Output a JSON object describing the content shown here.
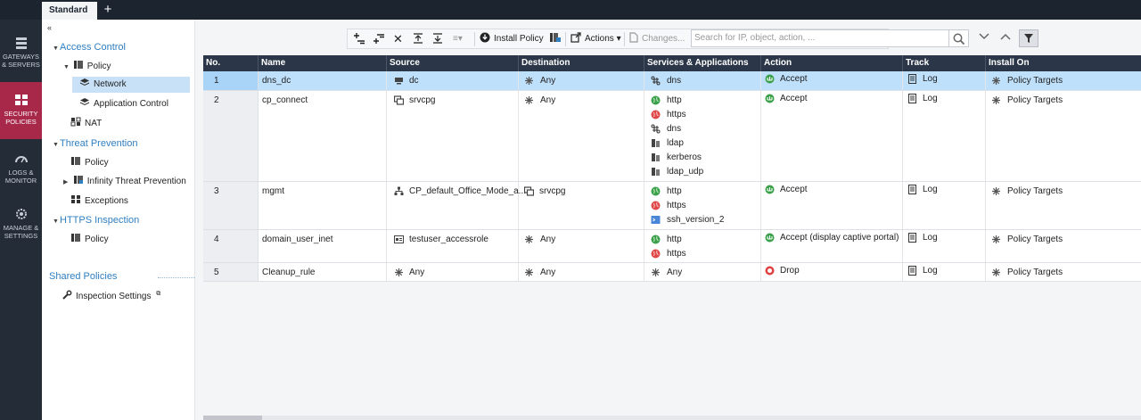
{
  "tabs": {
    "active": "Standard",
    "add": "+"
  },
  "leftnav": {
    "items": [
      {
        "label1": "GATEWAYS",
        "label2": "& SERVERS"
      },
      {
        "label1": "SECURITY",
        "label2": "POLICIES"
      },
      {
        "label1": "LOGS &",
        "label2": "MONITOR"
      },
      {
        "label1": "MANAGE &",
        "label2": "SETTINGS"
      }
    ]
  },
  "tree": {
    "collapse": "«",
    "access_control": "Access Control",
    "policy": "Policy",
    "network": "Network",
    "application_control": "Application Control",
    "nat": "NAT",
    "threat_prevention": "Threat Prevention",
    "tp_policy": "Policy",
    "infinity": "Infinity Threat Prevention",
    "exceptions": "Exceptions",
    "https_inspection": "HTTPS Inspection",
    "https_policy": "Policy",
    "shared_policies": "Shared Policies",
    "inspection_settings": "Inspection Settings"
  },
  "toolbar": {
    "install_policy": "Install Policy",
    "actions": "Actions ▾",
    "changes": "Changes...",
    "search_placeholder": "Search for IP, object, action, ..."
  },
  "columns": {
    "no": "No.",
    "name": "Name",
    "source": "Source",
    "destination": "Destination",
    "services": "Services & Applications",
    "action": "Action",
    "track": "Track",
    "install_on": "Install On"
  },
  "rows": [
    {
      "no": "1",
      "name": "dns_dc",
      "source": "dc",
      "destination": "Any",
      "services": [
        "dns"
      ],
      "action": "Accept",
      "track": "Log",
      "install_on": "Policy Targets"
    },
    {
      "no": "2",
      "name": "cp_connect",
      "source": "srvcpg",
      "destination": "Any",
      "services": [
        "http",
        "https",
        "dns",
        "ldap",
        "kerberos",
        "ldap_udp"
      ],
      "action": "Accept",
      "track": "Log",
      "install_on": "Policy Targets"
    },
    {
      "no": "3",
      "name": "mgmt",
      "source": "CP_default_Office_Mode_a...",
      "destination": "srvcpg",
      "services": [
        "http",
        "https",
        "ssh_version_2"
      ],
      "action": "Accept",
      "track": "Log",
      "install_on": "Policy Targets"
    },
    {
      "no": "4",
      "name": "domain_user_inet",
      "source": "testuser_accessrole",
      "destination": "Any",
      "services": [
        "http",
        "https"
      ],
      "action": "Accept (display captive portal)",
      "track": "Log",
      "install_on": "Policy Targets"
    },
    {
      "no": "5",
      "name": "Cleanup_rule",
      "source": "Any",
      "destination": "Any",
      "services": [
        "Any"
      ],
      "action": "Drop",
      "track": "Log",
      "install_on": "Policy Targets"
    }
  ],
  "colors": {
    "accent_active_nav": "#a8284a",
    "header_bg": "#2b3748",
    "selected_row": "#bfe0fb",
    "link_blue": "#2f7fc1"
  }
}
